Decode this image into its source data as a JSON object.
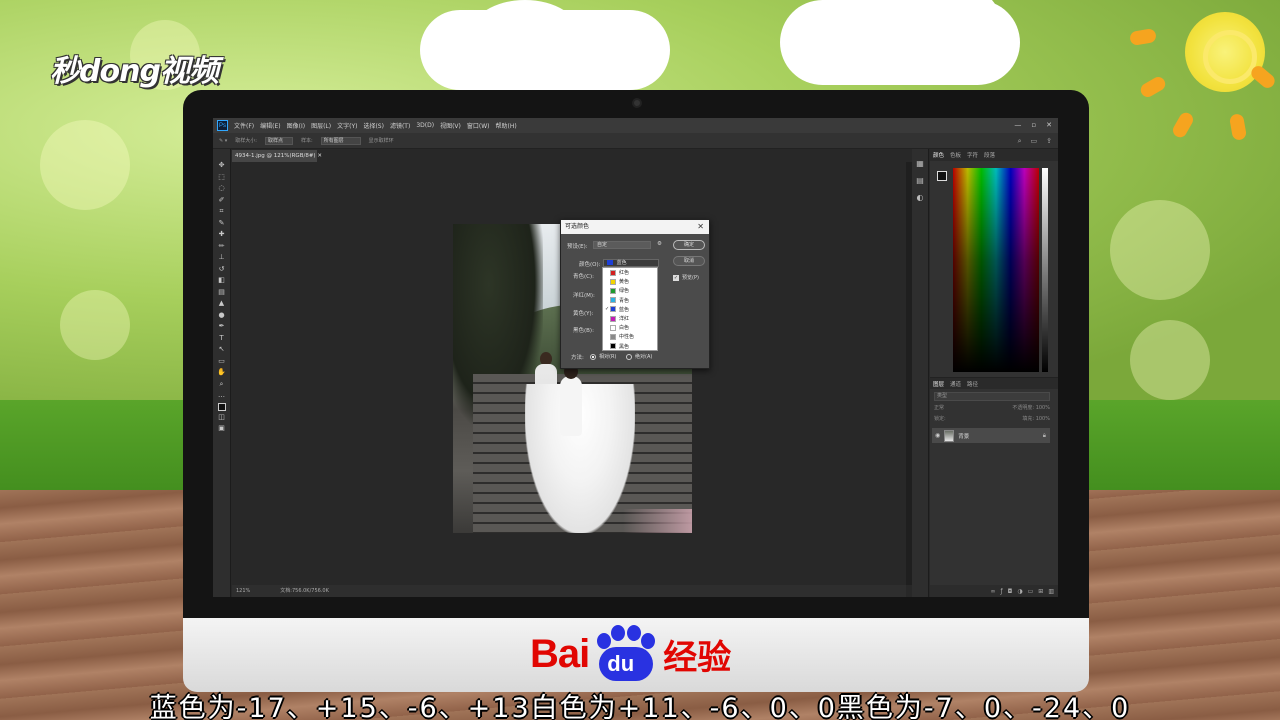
{
  "watermark": {
    "logo_text": "秒dong视频"
  },
  "brand": {
    "bai": "Bai",
    "du": "du",
    "jingyan": "经验"
  },
  "subtitle": "蓝色为-17、+15、-6、+13白色为+11、-6、0、0黑色为-7、0、-24、0",
  "photoshop": {
    "logo": "Ps",
    "menu": [
      "文件(F)",
      "编辑(E)",
      "图像(I)",
      "图层(L)",
      "文字(Y)",
      "选择(S)",
      "滤镜(T)",
      "3D(D)",
      "视图(V)",
      "窗口(W)",
      "帮助(H)"
    ],
    "window_controls": [
      "—",
      "▫",
      "✕"
    ],
    "options": {
      "size_label": "取样大小:",
      "size_value": "取样点",
      "sample_label": "样本:",
      "sample_value": "所有图层",
      "ring_label": "显示取样环"
    },
    "document_tab": "4934-1.jpg @ 121%(RGB/8#)",
    "status": {
      "zoom": "121%",
      "doc": "文档:756.0K/756.0K"
    },
    "color_panel": {
      "tabs": [
        "颜色",
        "色板",
        "字符",
        "段落"
      ]
    },
    "layers_panel": {
      "tabs": [
        "图层",
        "通道",
        "路径"
      ],
      "search_placeholder": "类型",
      "mode": "正常",
      "opacity_label": "不透明度: 100%",
      "lock_label": "锁定:",
      "fill_label": "填充: 100%",
      "layer_name": "背景"
    }
  },
  "dialog": {
    "title": "可选颜色",
    "preset_label": "预设(E):",
    "preset_value": "自定",
    "ok_label": "确定",
    "cancel_label": "取消",
    "preview_label": "预览(P)",
    "colors_label": "颜色(O):",
    "colors_value": "蓝色",
    "slider_labels": [
      "青色(C):",
      "洋红(M):",
      "黄色(Y):",
      "黑色(B):"
    ],
    "method_label": "方法:",
    "method_relative": "相对(R)",
    "method_absolute": "绝对(A)",
    "dropdown": [
      {
        "label": "红色",
        "color": "#d21f1f",
        "checked": false
      },
      {
        "label": "黄色",
        "color": "#f2d300",
        "checked": false
      },
      {
        "label": "绿色",
        "color": "#1f9a2e",
        "checked": false
      },
      {
        "label": "青色",
        "color": "#2bb0e0",
        "checked": false
      },
      {
        "label": "蓝色",
        "color": "#1d3fd6",
        "checked": true
      },
      {
        "label": "洋红",
        "color": "#c21cb4",
        "checked": false
      },
      {
        "label": "白色",
        "color": "#ffffff",
        "checked": false
      },
      {
        "label": "中性色",
        "color": "#8a8a8a",
        "checked": false
      },
      {
        "label": "黑色",
        "color": "#000000",
        "checked": false
      }
    ]
  }
}
